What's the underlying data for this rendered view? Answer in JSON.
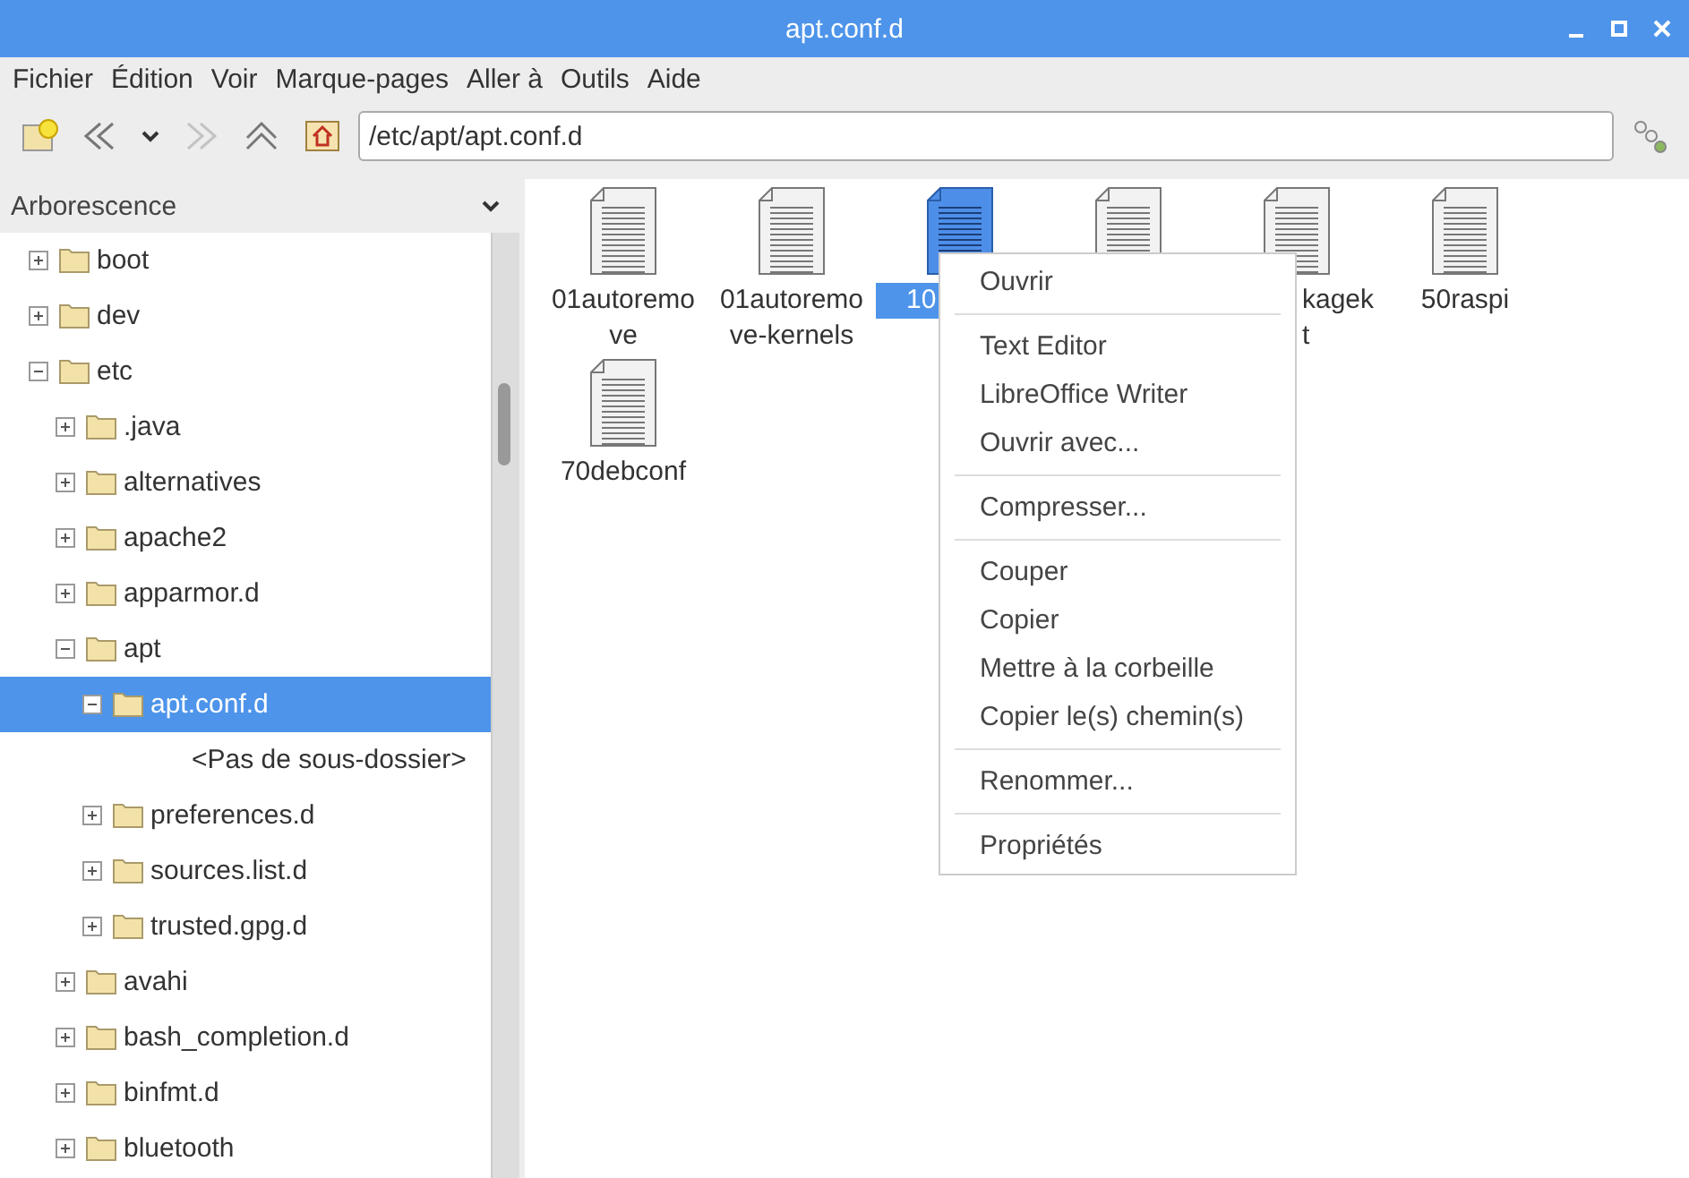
{
  "window": {
    "title": "apt.conf.d"
  },
  "menu_bar": [
    "Fichier",
    "Édition",
    "Voir",
    "Marque-pages",
    "Aller à",
    "Outils",
    "Aide"
  ],
  "toolbar": {
    "path": "/etc/apt/apt.conf.d",
    "forward_disabled": true
  },
  "sidebar": {
    "title": "Arborescence",
    "items": [
      {
        "kind": "folder",
        "label": "boot",
        "expanded": false,
        "selected": false
      },
      {
        "kind": "folder",
        "label": "dev",
        "expanded": false,
        "selected": false
      },
      {
        "kind": "folder",
        "label": "etc",
        "expanded": true,
        "selected": false,
        "children": [
          {
            "kind": "folder",
            "label": ".java",
            "expanded": false,
            "selected": false
          },
          {
            "kind": "folder",
            "label": "alternatives",
            "expanded": false,
            "selected": false
          },
          {
            "kind": "folder",
            "label": "apache2",
            "expanded": false,
            "selected": false
          },
          {
            "kind": "folder",
            "label": "apparmor.d",
            "expanded": false,
            "selected": false
          },
          {
            "kind": "folder",
            "label": "apt",
            "expanded": true,
            "selected": false,
            "children": [
              {
                "kind": "folder",
                "label": "apt.conf.d",
                "expanded": true,
                "selected": true,
                "children": [
                  {
                    "kind": "placeholder",
                    "label": "<Pas de sous-dossier>"
                  }
                ]
              },
              {
                "kind": "folder",
                "label": "preferences.d",
                "expanded": false,
                "selected": false
              },
              {
                "kind": "folder",
                "label": "sources.list.d",
                "expanded": false,
                "selected": false
              },
              {
                "kind": "folder",
                "label": "trusted.gpg.d",
                "expanded": false,
                "selected": false
              }
            ]
          },
          {
            "kind": "folder",
            "label": "avahi",
            "expanded": false,
            "selected": false
          },
          {
            "kind": "folder",
            "label": "bash_completion.d",
            "expanded": false,
            "selected": false
          },
          {
            "kind": "folder",
            "label": "binfmt.d",
            "expanded": false,
            "selected": false
          },
          {
            "kind": "folder",
            "label": "bluetooth",
            "expanded": false,
            "selected": false
          }
        ]
      }
    ]
  },
  "files": [
    {
      "kind": "full",
      "lines": [
        "01autoremo",
        "ve"
      ],
      "selected": false
    },
    {
      "kind": "full",
      "lines": [
        "01autoremo",
        "ve-kernels"
      ],
      "selected": false
    },
    {
      "kind": "partial",
      "lines": [
        "10"
      ],
      "selected": true
    },
    {
      "kind": "hidden",
      "selected": false
    },
    {
      "kind": "partial",
      "lines": [
        "kagek",
        "t"
      ],
      "selected": false
    },
    {
      "kind": "full",
      "lines": [
        "50raspi"
      ],
      "selected": false
    },
    {
      "kind": "full",
      "lines": [
        "70debconf"
      ],
      "selected": false
    }
  ],
  "context_menu": [
    [
      "Ouvrir"
    ],
    [
      "Text Editor",
      "LibreOffice Writer",
      "Ouvrir avec..."
    ],
    [
      "Compresser..."
    ],
    [
      "Couper",
      "Copier",
      "Mettre à la corbeille",
      "Copier le(s) chemin(s)"
    ],
    [
      "Renommer..."
    ],
    [
      "Propriétés"
    ]
  ]
}
